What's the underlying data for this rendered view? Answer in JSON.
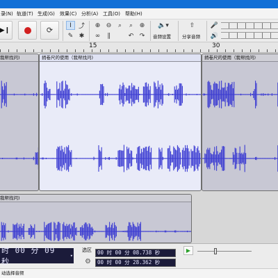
{
  "menubar": {
    "items": [
      "录(N)",
      "轨道(T)",
      "生成(G)",
      "效果(C)",
      "分析(A)",
      "工具(O)",
      "帮助(H)"
    ]
  },
  "toolbar": {
    "audio_setup_label": "音频设置",
    "share_audio_label": "分享音频"
  },
  "ruler": {
    "labels": [
      "15",
      "30"
    ]
  },
  "tracks": {
    "clip_titles": [
      "我帮找问)",
      "捎卷尺的使用（我帮找问)",
      "捎卷尺的使用（我帮找问)",
      "我帮找问)"
    ]
  },
  "bottom": {
    "time_display": "时 00 分 09 秒",
    "selection_label": "选区",
    "selection_start": "00 时 00 分 08.738 秒",
    "selection_end": "00 时 00 分 28.362 秒"
  },
  "status": {
    "text": "动选择音频"
  },
  "colors": {
    "titlebar": "#1270d6",
    "waveform": "#3b3bd2",
    "play": "#2aa02a",
    "record": "#d22020"
  }
}
